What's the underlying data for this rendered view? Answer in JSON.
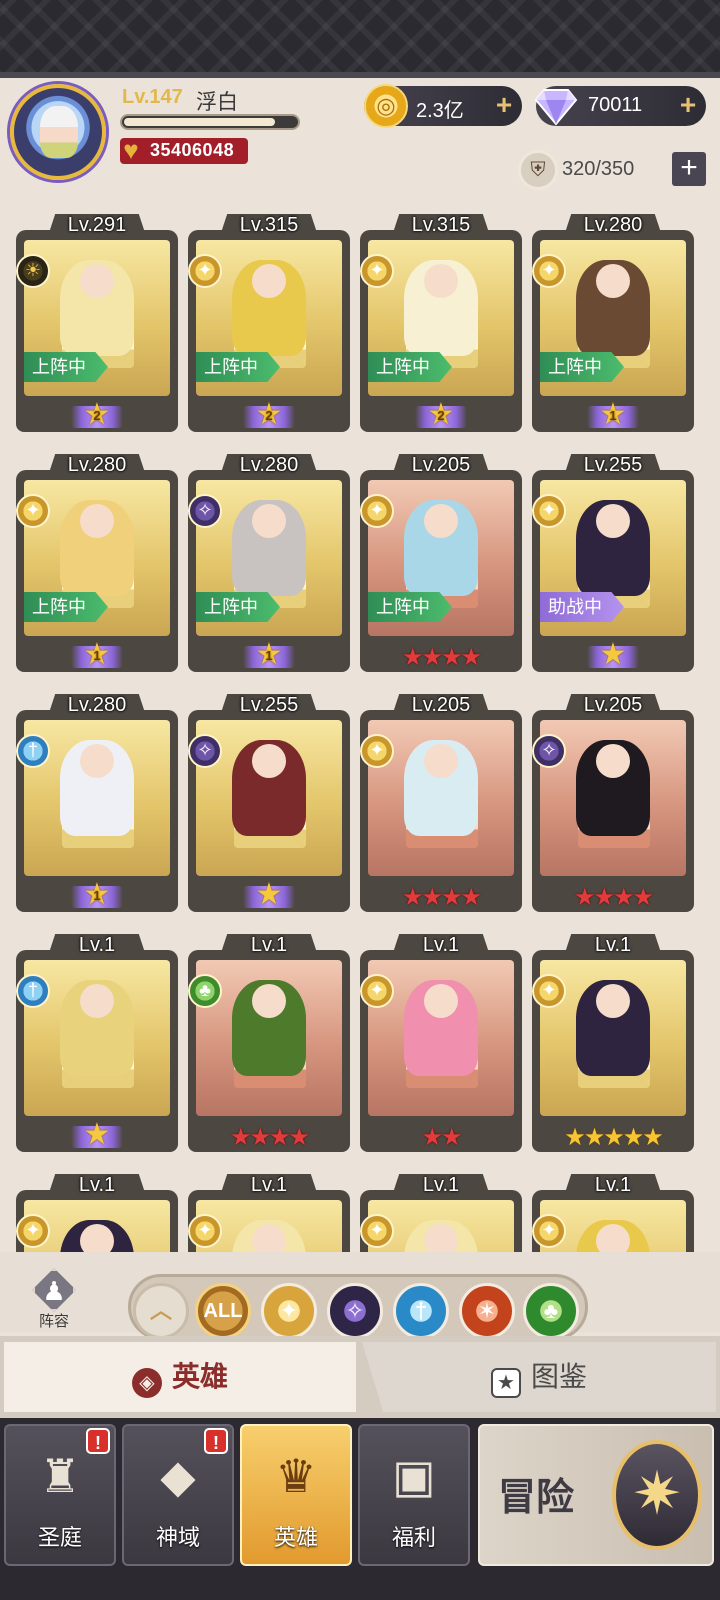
{
  "player": {
    "level": "Lv.147",
    "name": "浮白",
    "xp_fraction": 0.88,
    "power": "35406048"
  },
  "currencies": {
    "gold": "2.3亿",
    "diamonds": "70011",
    "capacity": "320/350"
  },
  "heroes": [
    {
      "level": "Lv.291",
      "faction": "sun",
      "status": "上阵中",
      "rarity": "wing",
      "wing_number": "2",
      "bg": "gold"
    },
    {
      "level": "Lv.315",
      "faction": "light",
      "status": "上阵中",
      "rarity": "wing",
      "wing_number": "2",
      "bg": "gold"
    },
    {
      "level": "Lv.315",
      "faction": "light",
      "status": "上阵中",
      "rarity": "wing",
      "wing_number": "2",
      "bg": "gold"
    },
    {
      "level": "Lv.280",
      "faction": "light",
      "status": "上阵中",
      "rarity": "wing",
      "wing_number": "1",
      "bg": "gold"
    },
    {
      "level": "Lv.280",
      "faction": "light",
      "status": "上阵中",
      "rarity": "wing",
      "wing_number": "1",
      "bg": "gold"
    },
    {
      "level": "Lv.280",
      "faction": "dark",
      "status": "上阵中",
      "rarity": "wing",
      "wing_number": "1",
      "bg": "gold"
    },
    {
      "level": "Lv.205",
      "faction": "light",
      "status": "上阵中",
      "rarity": "red",
      "stars": 4,
      "bg": "red"
    },
    {
      "level": "Lv.255",
      "faction": "light",
      "status": "助战中",
      "rarity": "wing",
      "wing_number": "",
      "bg": "gold"
    },
    {
      "level": "Lv.280",
      "faction": "holy",
      "status": "",
      "rarity": "wing",
      "wing_number": "1",
      "bg": "gold"
    },
    {
      "level": "Lv.255",
      "faction": "dark",
      "status": "",
      "rarity": "wing",
      "wing_number": "",
      "bg": "gold"
    },
    {
      "level": "Lv.205",
      "faction": "light",
      "status": "",
      "rarity": "red",
      "stars": 4,
      "bg": "red"
    },
    {
      "level": "Lv.205",
      "faction": "dark",
      "status": "",
      "rarity": "red",
      "stars": 4,
      "bg": "red"
    },
    {
      "level": "Lv.1",
      "faction": "holy",
      "status": "",
      "rarity": "wing",
      "wing_number": "",
      "bg": "gold"
    },
    {
      "level": "Lv.1",
      "faction": "nature",
      "status": "",
      "rarity": "red",
      "stars": 4,
      "bg": "red"
    },
    {
      "level": "Lv.1",
      "faction": "light",
      "status": "",
      "rarity": "red",
      "stars": 2,
      "bg": "red"
    },
    {
      "level": "Lv.1",
      "faction": "light",
      "status": "",
      "rarity": "gold",
      "stars": 5,
      "bg": "gold"
    },
    {
      "level": "Lv.1",
      "faction": "light",
      "status": "",
      "rarity": "none",
      "bg": "gold"
    },
    {
      "level": "Lv.1",
      "faction": "light",
      "status": "",
      "rarity": "none",
      "bg": "gold"
    },
    {
      "level": "Lv.1",
      "faction": "light",
      "status": "",
      "rarity": "none",
      "bg": "gold"
    },
    {
      "level": "Lv.1",
      "faction": "light",
      "status": "",
      "rarity": "none",
      "bg": "gold"
    }
  ],
  "filters": {
    "lineup_label": "阵容",
    "all_label": "ALL",
    "items": [
      "sort",
      "all",
      "light",
      "dark",
      "holy",
      "beast",
      "nature"
    ]
  },
  "tabs": {
    "heroes": "英雄",
    "codex": "图鉴"
  },
  "nav": {
    "sanctuary": "圣庭",
    "divine": "神域",
    "heroes": "英雄",
    "welfare": "福利",
    "adventure": "冒险"
  }
}
